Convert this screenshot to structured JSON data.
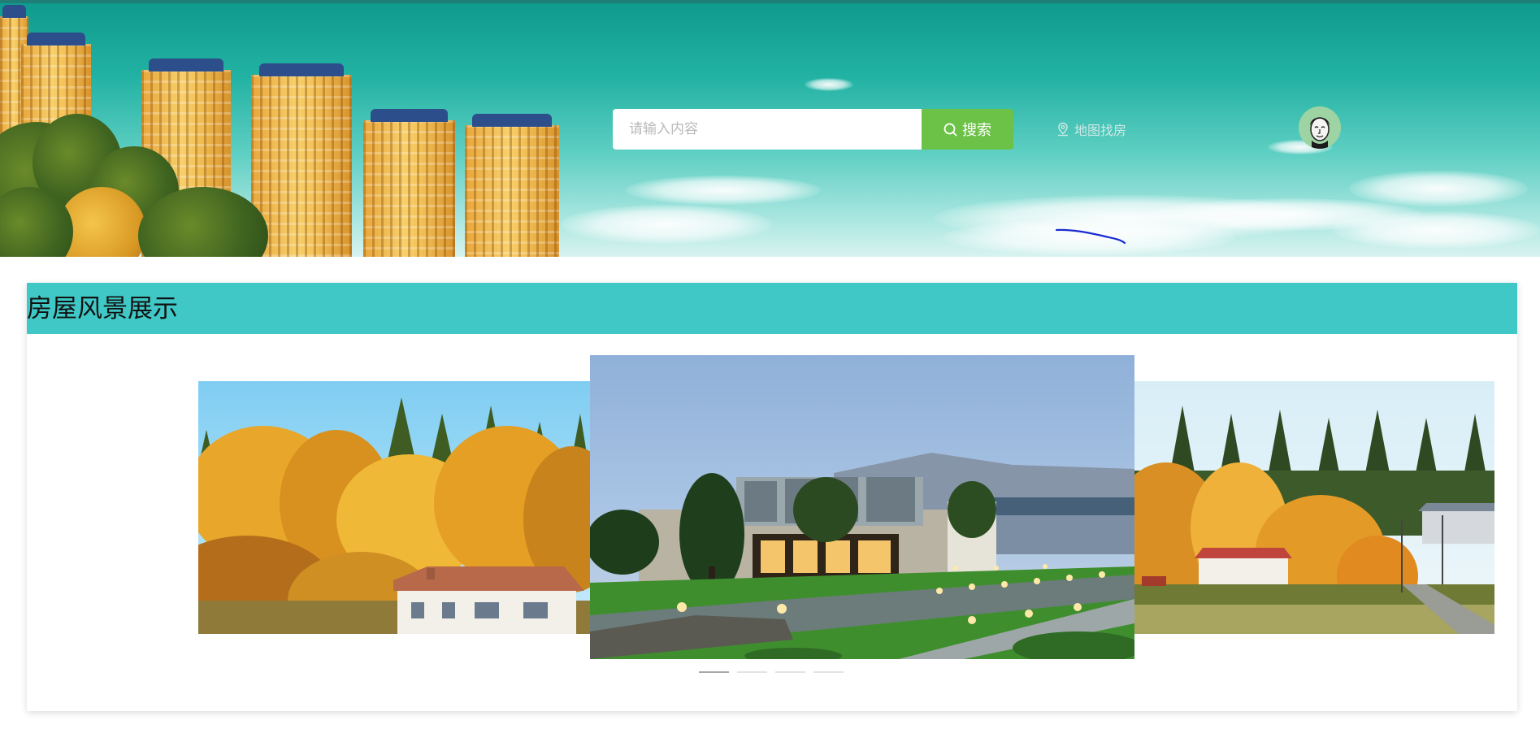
{
  "header": {
    "search": {
      "placeholder": "请输入内容",
      "value": "",
      "button_label": "搜索"
    },
    "map_link_label": "地图找房",
    "avatar_icon": "user-avatar-icon"
  },
  "section": {
    "title": "房屋风景展示"
  },
  "carousel": {
    "slides": [
      {
        "name": "autumn-forest-house"
      },
      {
        "name": "lakeside-villa-night"
      },
      {
        "name": "autumn-village"
      }
    ],
    "indicator_count": 4,
    "active_index": 0
  },
  "colors": {
    "search_button": "#6cc247",
    "section_header": "#40c8c6",
    "banner_sky": "#22b2a3"
  }
}
